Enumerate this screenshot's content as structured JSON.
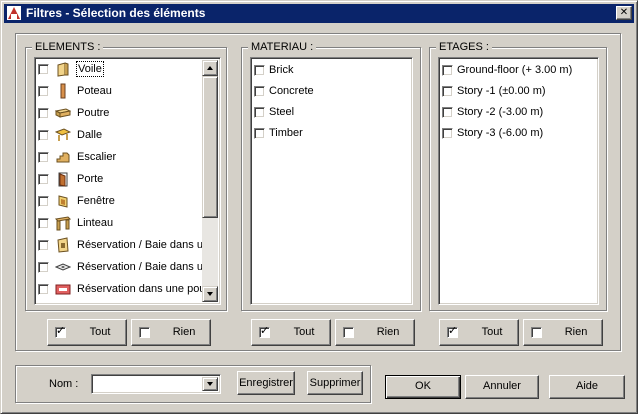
{
  "window": {
    "title": "Filtres - Sélection des éléments",
    "close_label": "✕"
  },
  "elements": {
    "label": "ELEMENTS :",
    "items": [
      {
        "label": "Voile",
        "icon": "wall-icon"
      },
      {
        "label": "Poteau",
        "icon": "column-icon"
      },
      {
        "label": "Poutre",
        "icon": "beam-icon"
      },
      {
        "label": "Dalle",
        "icon": "slab-icon"
      },
      {
        "label": "Escalier",
        "icon": "stair-icon"
      },
      {
        "label": "Porte",
        "icon": "door-icon"
      },
      {
        "label": "Fenêtre",
        "icon": "window-icon"
      },
      {
        "label": "Linteau",
        "icon": "lintel-icon"
      },
      {
        "label": "Réservation / Baie dans un",
        "icon": "wall-opening-icon"
      },
      {
        "label": "Réservation / Baie dans un",
        "icon": "slab-opening-icon"
      },
      {
        "label": "Réservation dans une pou",
        "icon": "beam-opening-icon"
      }
    ]
  },
  "materiau": {
    "label": "MATERIAU :",
    "items": [
      "Brick",
      "Concrete",
      "Steel",
      "Timber"
    ]
  },
  "etages": {
    "label": "ETAGES :",
    "items": [
      "Ground-floor (+ 3.00 m)",
      "Story -1 (±0.00 m)",
      "Story -2 (-3.00 m)",
      "Story -3 (-6.00 m)"
    ]
  },
  "buttons": {
    "all": "Tout",
    "none": "Rien",
    "check": "✓",
    "ok": "OK",
    "cancel": "Annuler",
    "help": "Aide",
    "save": "Enregistrer",
    "delete": "Supprimer"
  },
  "name_field": {
    "label": "Nom :",
    "value": ""
  },
  "colors": {
    "titlebar": "#0a246a",
    "face": "#d4d0c8"
  }
}
